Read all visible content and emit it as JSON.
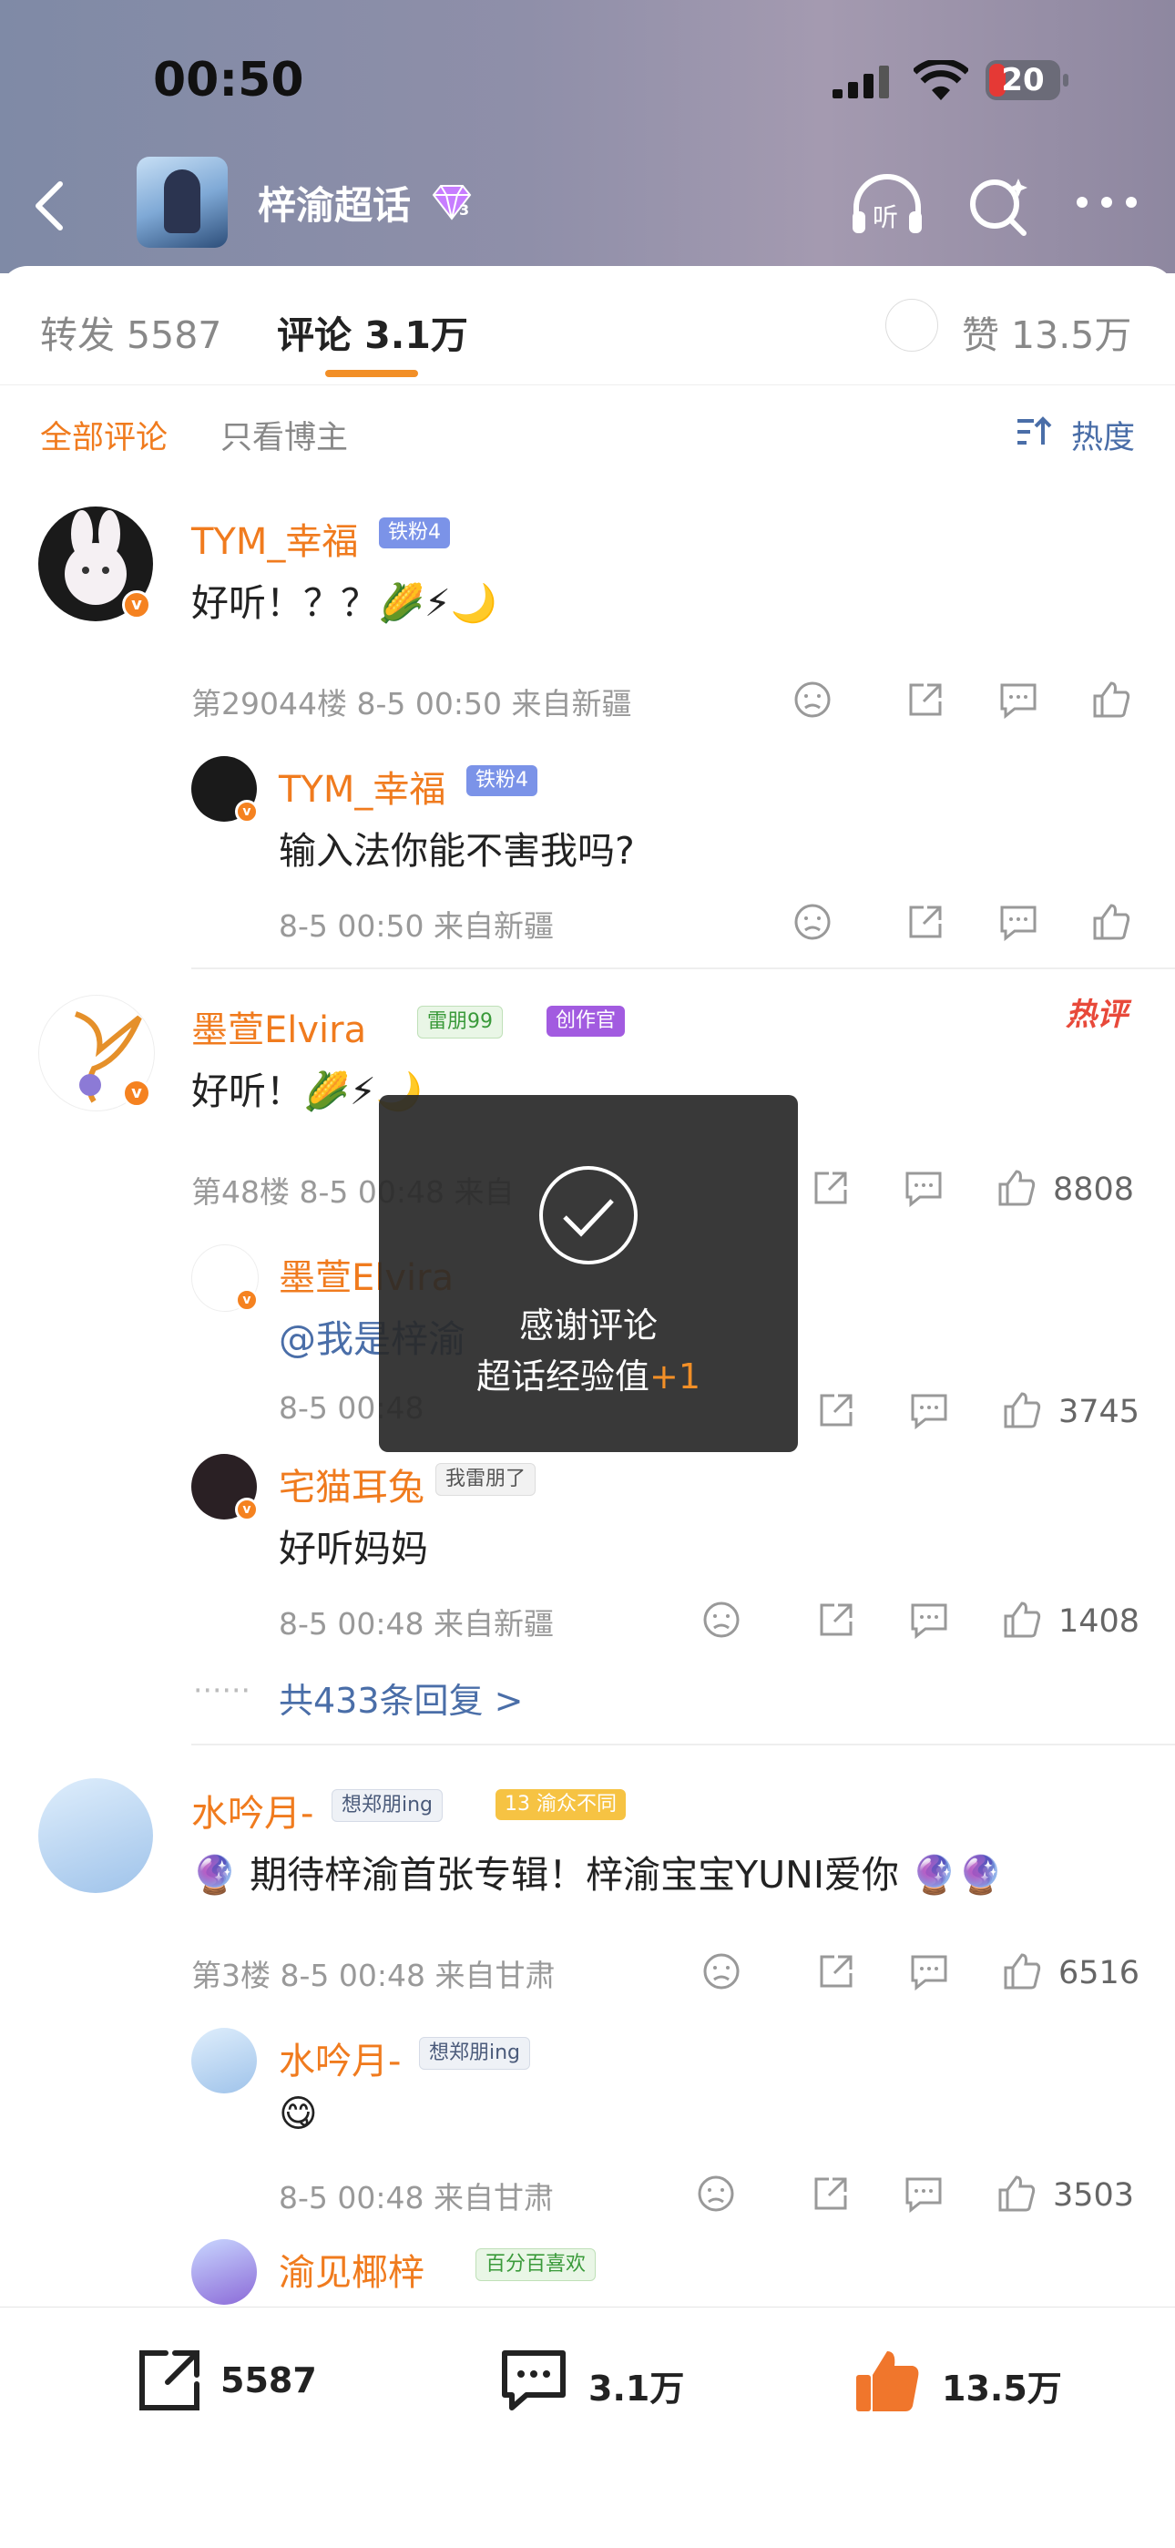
{
  "status": {
    "time": "00:50",
    "battery": "20"
  },
  "nav": {
    "title": "梓渝超话",
    "level": "3",
    "listen_label": "听"
  },
  "tabs": {
    "repost": "转发 5587",
    "comments": "评论 3.1万",
    "likes": "赞 13.5万"
  },
  "filters": {
    "all": "全部评论",
    "author_only": "只看博主",
    "sort": "热度"
  },
  "comments": [
    {
      "user": "TYM_幸福",
      "fan_badge": "铁粉4",
      "text": "好听！？？🌽⚡🌙",
      "meta": "第29044楼 8-5 00:50 来自新疆",
      "replies": [
        {
          "user": "TYM_幸福",
          "fan_badge": "铁粉4",
          "text": "输入法你能不害我吗?",
          "meta": "8-5 00:50 来自新疆"
        }
      ]
    },
    {
      "user": "墨萱Elvira",
      "badge1": "雷朋99",
      "badge2": "创作官",
      "hot": "热评",
      "text": "好听！🌽⚡🌙",
      "meta": "第48楼 8-5 00:48 来自",
      "likes": "8808",
      "replies": [
        {
          "user": "墨萱Elvira",
          "text": "@我是梓渝",
          "meta": "8-5 00:48",
          "likes": "3745"
        },
        {
          "user": "宅猫耳兔",
          "badge": "我雷朋了",
          "text": "好听妈妈",
          "meta": "8-5 00:48 来自新疆",
          "likes": "1408"
        }
      ],
      "more": "共433条回复 >"
    },
    {
      "user": "水吟月-",
      "badge1": "想郑朋ing",
      "badge2": "渝众不同",
      "badge2_level": "13",
      "text": "期待梓渝首张专辑！梓渝宝宝YUNI爱你",
      "meta": "第3楼 8-5 00:48 来自甘肃",
      "likes": "6516",
      "replies": [
        {
          "user": "水吟月-",
          "badge": "想郑朋ing",
          "text": "😋",
          "meta": "8-5 00:48 来自甘肃",
          "likes": "3503"
        },
        {
          "user": "渝见椰梓",
          "badge": "百分百喜欢"
        }
      ]
    }
  ],
  "toast": {
    "line1": "感谢评论",
    "line2": "超话经验值",
    "plus": "+1"
  },
  "bottom": {
    "reposts": "5587",
    "comments": "3.1万",
    "likes": "13.5万"
  },
  "colors": {
    "accent": "#f07b1e",
    "link": "#4a6ea8",
    "verified": "#f58220"
  }
}
